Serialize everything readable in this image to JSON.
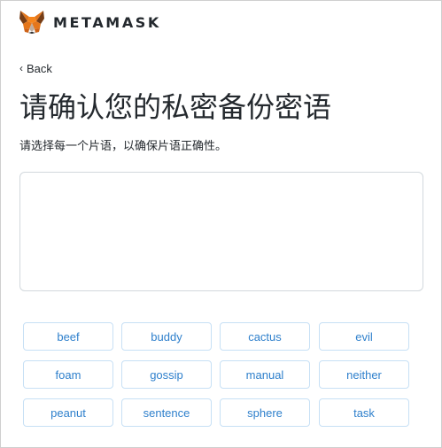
{
  "brand": {
    "name": "METAMASK",
    "logo_icon": "metamask-fox-icon"
  },
  "nav": {
    "back_label": "Back",
    "back_icon": "chevron-left-icon"
  },
  "page": {
    "title": "请确认您的私密备份密语",
    "subtitle": "请选择每一个片语，以确保片语正确性。"
  },
  "words": [
    "beef",
    "buddy",
    "cactus",
    "evil",
    "foam",
    "gossip",
    "manual",
    "neither",
    "peanut",
    "sentence",
    "sphere",
    "task"
  ],
  "colors": {
    "accent": "#2f80cc",
    "button_border": "#c7e0f5",
    "text": "#24292e",
    "box_border": "#d2d8dd"
  }
}
